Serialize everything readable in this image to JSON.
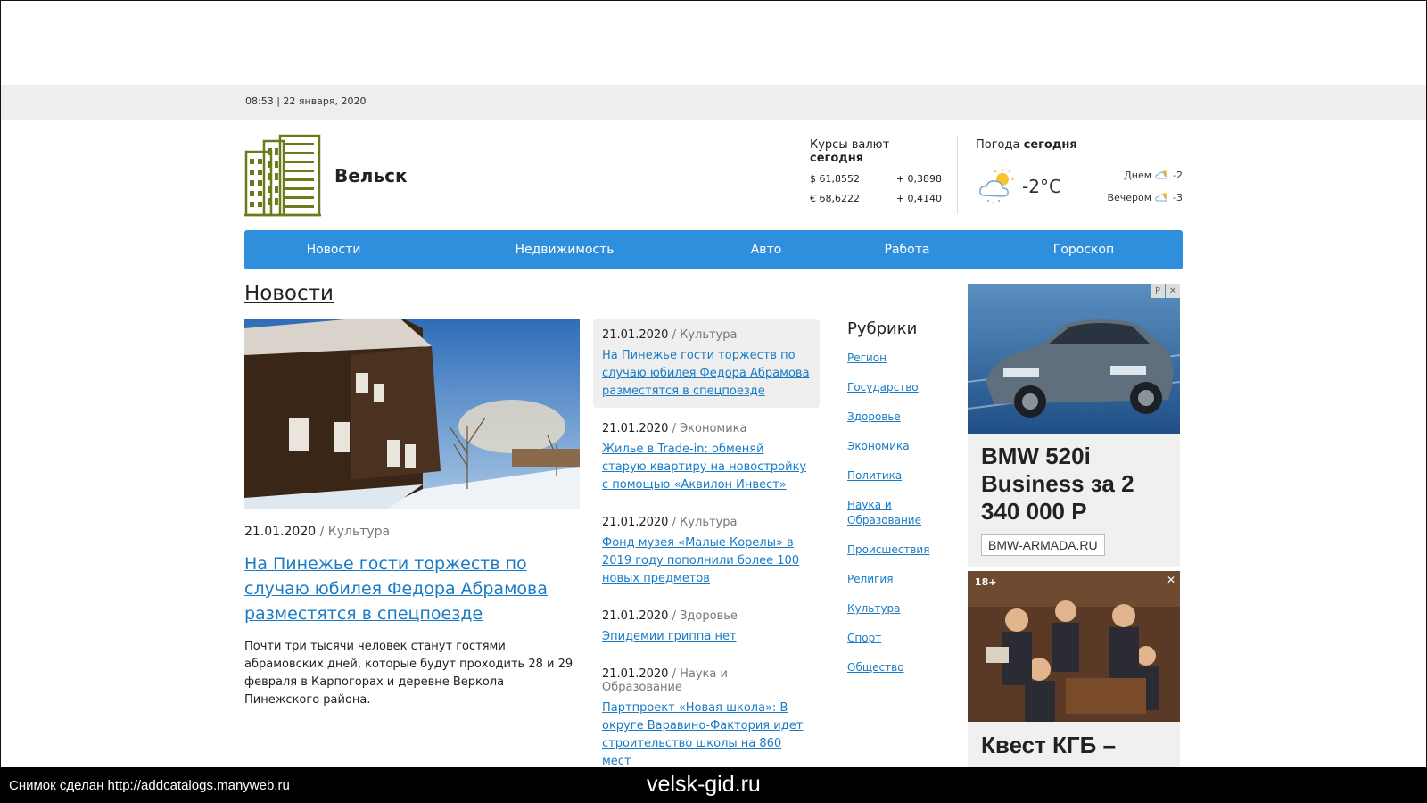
{
  "header": {
    "datetime": "08:53 | 22 января, 2020",
    "site_name": "Вельск"
  },
  "rates": {
    "label": "Курсы валют ",
    "label_bold": "сегодня",
    "items": [
      {
        "value": "$ 61,8552",
        "change": "+ 0,3898"
      },
      {
        "value": "€ 68,6222",
        "change": "+ 0,4140"
      }
    ]
  },
  "weather": {
    "label": "Погода ",
    "label_bold": "сегодня",
    "current_temp": "-2°C",
    "icon": "cloud-sun-icon",
    "day": {
      "label": "Днем",
      "temp": "-2"
    },
    "evening": {
      "label": "Вечером",
      "temp": "-3"
    }
  },
  "nav": {
    "items": [
      {
        "label": "Новости"
      },
      {
        "label": "Недвижимость"
      },
      {
        "label": "Авто"
      },
      {
        "label": "Работа"
      },
      {
        "label": "Гороскоп"
      }
    ]
  },
  "section": {
    "title": "Новости"
  },
  "main_news": {
    "date": "21.01.2020",
    "category": " / Культура",
    "title": "На Пинежье гости торжеств по случаю юбилея Федора Абрамова разместятся в спецпоезде",
    "lead": "Почти три тысячи человек станут гостями абрамовских дней, которые будут проходить 28 и 29 февраля в Карпогорах и деревне Веркола Пинежского района."
  },
  "news_list": [
    {
      "date": "21.01.2020",
      "category": " / Культура",
      "title": "На Пинежье гости торжеств по случаю юбилея Федора Абрамова разместятся в спецпоезде"
    },
    {
      "date": "21.01.2020",
      "category": " / Экономика",
      "title": "Жилье в Trade-in: обменяй старую квартиру на новостройку с помощью «Аквилон Инвест»"
    },
    {
      "date": "21.01.2020",
      "category": " / Культура",
      "title": "Фонд музея «Малые Корелы» в 2019 году пополнили более 100 новых предметов"
    },
    {
      "date": "21.01.2020",
      "category": " / Здоровье",
      "title": "Эпидемии гриппа нет"
    },
    {
      "date": "21.01.2020",
      "category": " / Наука и Образование",
      "title": "Партпроект «Новая школа»: В округе Варавино-Фактория идет строительство школы на 860 мест"
    }
  ],
  "rubrics": {
    "title": "Рубрики",
    "items": [
      "Регион",
      "Государство",
      "Здоровье",
      "Экономика",
      "Политика",
      "Наука и Образование",
      "Происшествия",
      "Религия",
      "Культура",
      "Спорт",
      "Общество"
    ]
  },
  "ad1": {
    "badge_p": "P",
    "badge_close": "✕",
    "headline": "BMW 520i Business за 2 340 000 Р",
    "domain": "BMW-ARMADA.RU"
  },
  "ad2": {
    "age": "18+",
    "close": "✕",
    "headline": "Квест КГБ –"
  },
  "footer": {
    "left": "Снимок сделан http://addcatalogs.manyweb.ru",
    "center": "velsk-gid.ru"
  },
  "colors": {
    "nav_bg": "#2f8fdd",
    "link": "#1a7bc4",
    "logo": "#6b7a1a"
  }
}
